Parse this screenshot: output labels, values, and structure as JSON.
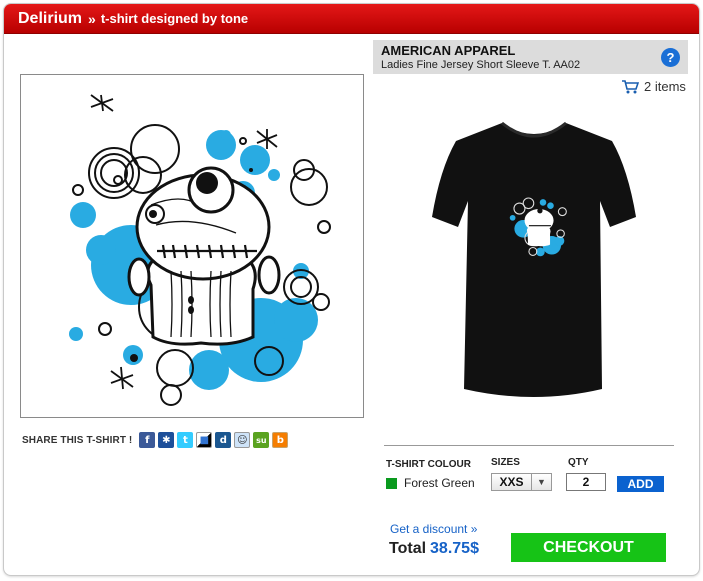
{
  "header": {
    "brand": "Delirium",
    "separator": "»",
    "subtitle": "t-shirt designed by tone"
  },
  "design": {
    "accent_color": "#29abe2",
    "image": "doll-with-bubbles-artwork"
  },
  "share": {
    "label": "SHARE THIS T-SHIRT !",
    "icons": [
      {
        "name": "facebook-icon",
        "glyph": "f",
        "color": "#3b5998"
      },
      {
        "name": "myspace-icon",
        "glyph": "✱",
        "color": "#1d4f9a"
      },
      {
        "name": "twitter-icon",
        "glyph": "t",
        "color": "#33ccff"
      },
      {
        "name": "delicious-icon",
        "glyph": "■",
        "color": "#ffffff"
      },
      {
        "name": "digg-icon",
        "glyph": "d",
        "color": "#1b5790"
      },
      {
        "name": "reddit-icon",
        "glyph": "☺",
        "color": "#cee3f8"
      },
      {
        "name": "stumbleupon-icon",
        "glyph": "su",
        "color": "#5aa320"
      },
      {
        "name": "blogger-icon",
        "glyph": "b",
        "color": "#f57d00"
      }
    ]
  },
  "product": {
    "brand": "AMERICAN APPAREL",
    "model": "Ladies Fine Jersey Short Sleeve T. AA02",
    "help_glyph": "?",
    "shirt_color": "#111111"
  },
  "cart": {
    "count_label": "2 items"
  },
  "options": {
    "colour_label": "T-SHIRT COLOUR",
    "colour_value": "Forest Green",
    "colour_swatch": "#0a9a1e",
    "sizes_label": "SIZES",
    "size_value": "XXS",
    "qty_label": "QTY",
    "qty_value": "2",
    "add_label": "ADD"
  },
  "checkout": {
    "discount_link": "Get a discount »",
    "total_label": "Total",
    "total_amount": "38.75$",
    "checkout_label": "CHECKOUT"
  }
}
